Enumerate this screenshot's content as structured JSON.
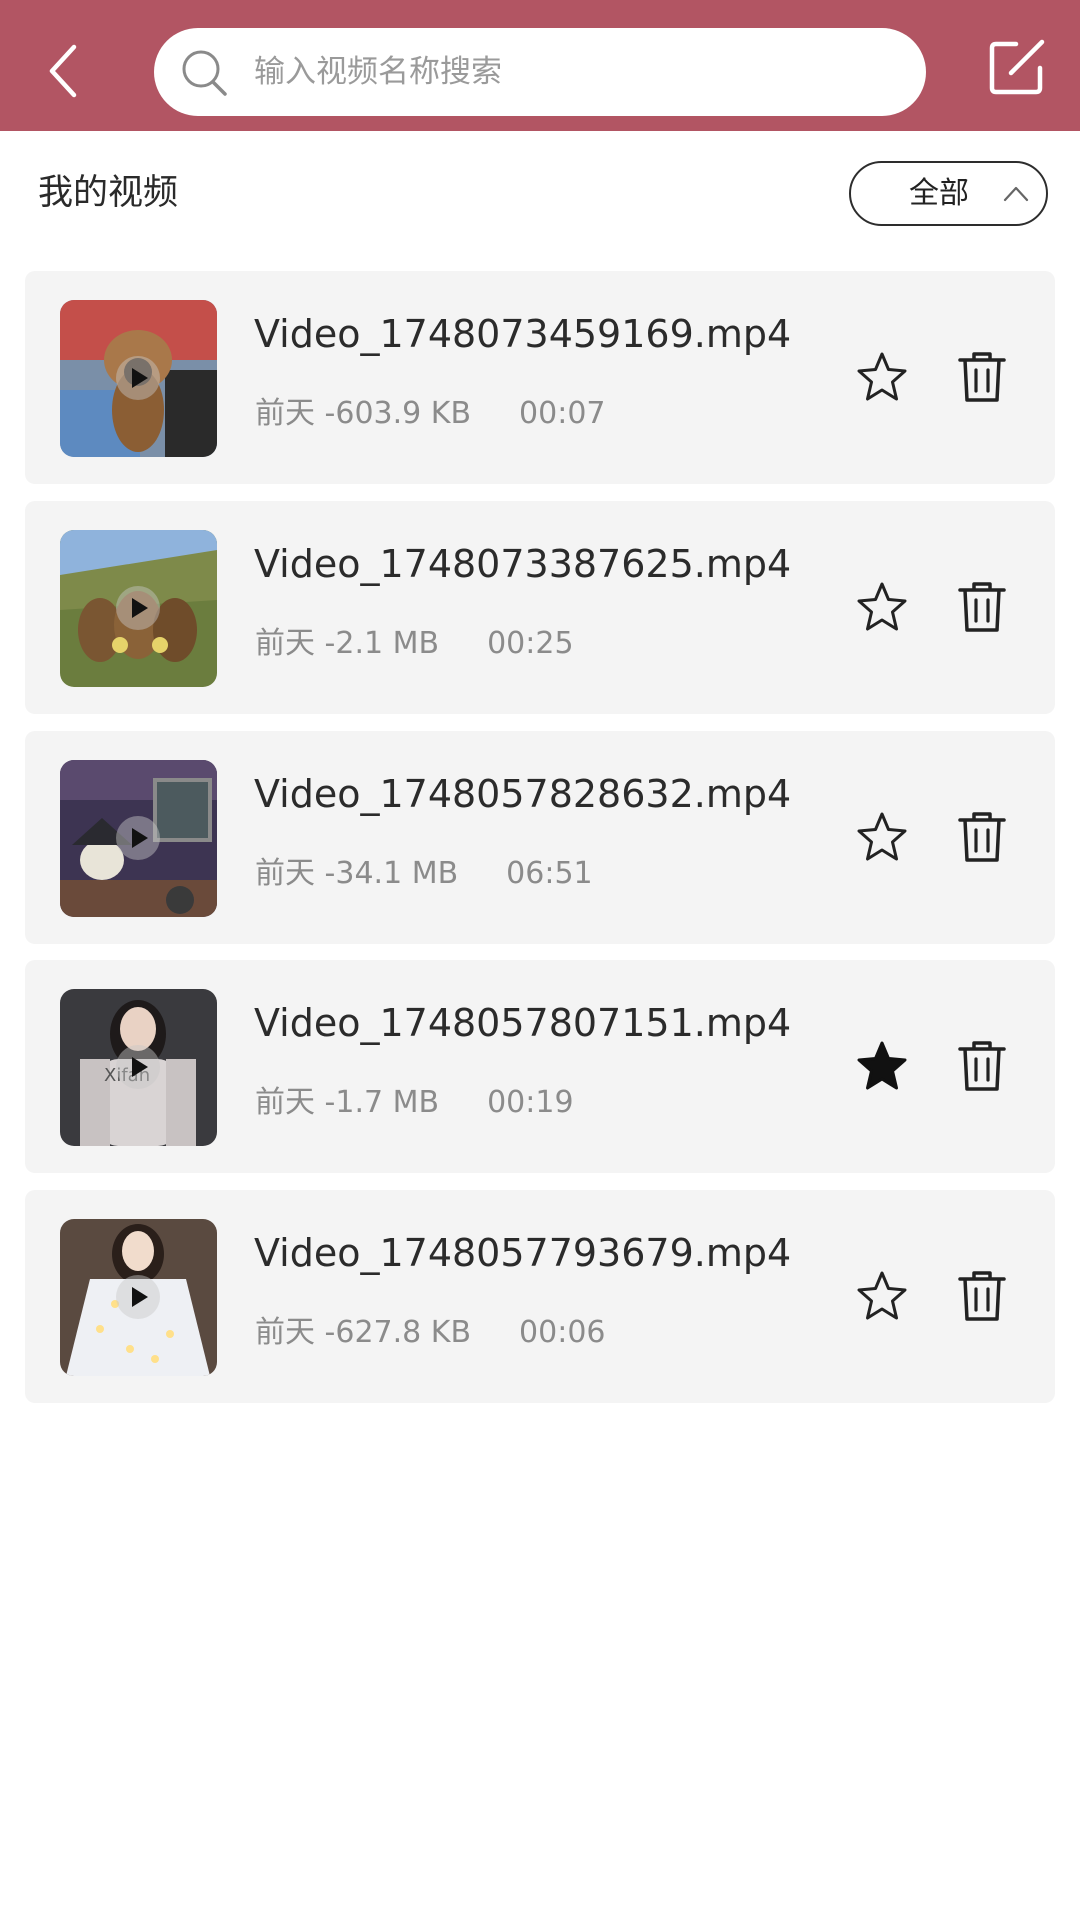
{
  "header": {
    "background_color": "#b25563",
    "back_icon": "chevron-left-icon",
    "search": {
      "placeholder": "输入视频名称搜索",
      "value": "",
      "icon": "search-icon"
    },
    "edit_icon": "edit-icon"
  },
  "section": {
    "title": "我的视频",
    "filter_label": "全部",
    "filter_icon": "chevron-up-icon"
  },
  "videos": [
    {
      "name": "Video_1748073459169.mp4",
      "meta": "前天 -603.9 KB",
      "duration": "00:07",
      "favorited": false
    },
    {
      "name": "Video_1748073387625.mp4",
      "meta": "前天 -2.1 MB",
      "duration": "00:25",
      "favorited": false
    },
    {
      "name": "Video_1748057828632.mp4",
      "meta": "前天 -34.1 MB",
      "duration": "06:51",
      "favorited": false
    },
    {
      "name": "Video_1748057807151.mp4",
      "meta": "前天 -1.7 MB",
      "duration": "00:19",
      "favorited": true
    },
    {
      "name": "Video_1748057793679.mp4",
      "meta": "前天 -627.8 KB",
      "duration": "00:06",
      "favorited": false
    }
  ]
}
